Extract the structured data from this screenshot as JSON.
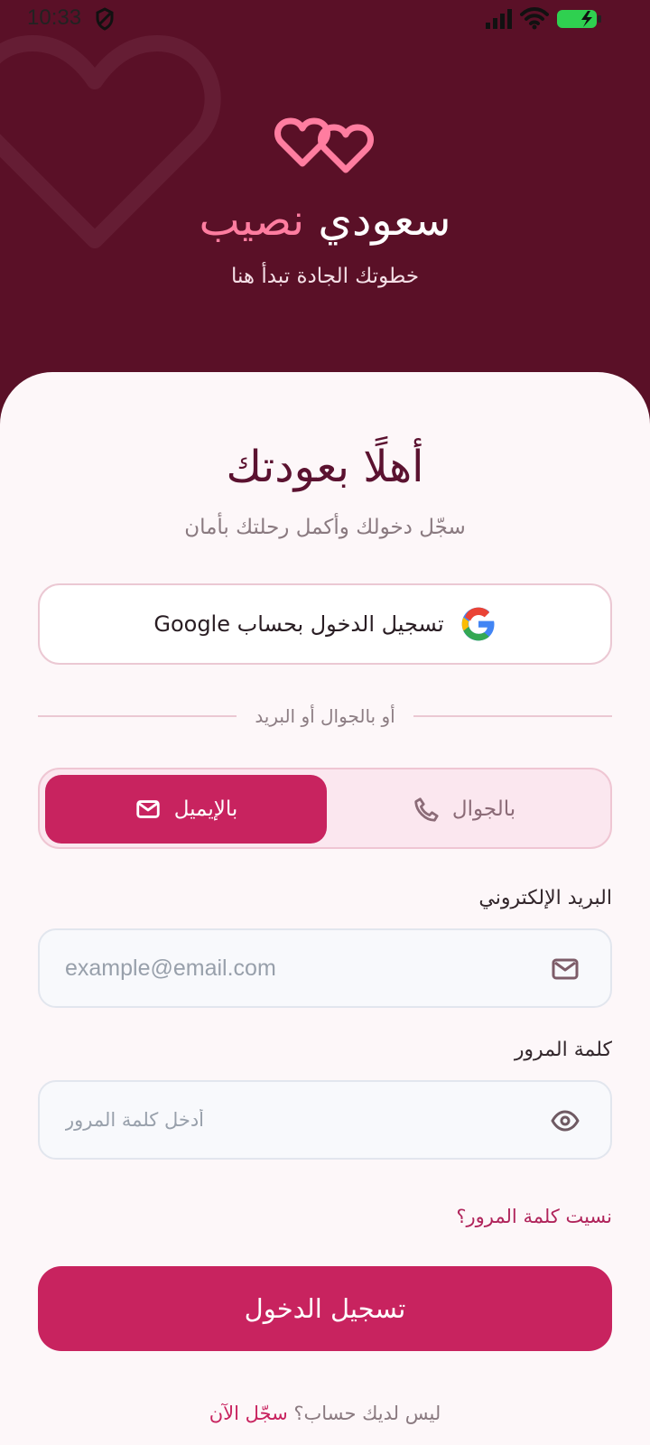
{
  "status_bar": {
    "time": "10:33"
  },
  "header": {
    "brand_main": "سعودي",
    "brand_accent": "نصيب",
    "tagline": "خطوتك الجادة تبدأ هنا"
  },
  "welcome": {
    "title": "أهلًا بعودتك",
    "subtitle": "سجّل دخولك وأكمل رحلتك بأمان"
  },
  "google": {
    "label": "تسجيل الدخول بحساب Google"
  },
  "divider": {
    "label": "أو بالجوال أو البريد"
  },
  "method_toggle": {
    "phone_label": "بالجوال",
    "email_label": "بالإيميل",
    "selected": "بالإيميل"
  },
  "email": {
    "label": "البريد الإلكتروني",
    "placeholder": "example@email.com",
    "value": ""
  },
  "password": {
    "label": "كلمة المرور",
    "placeholder": "أدخل كلمة المرور",
    "value": ""
  },
  "links": {
    "forgot_password": "نسيت كلمة المرور؟"
  },
  "actions": {
    "login": "تسجيل الدخول"
  },
  "signup": {
    "prompt": "ليس لديك حساب؟",
    "link": "سجّل الآن"
  },
  "icons": {
    "status": [
      "shield-icon",
      "signal-icon",
      "wifi-icon",
      "battery-icon"
    ],
    "logo": "hearts-icon",
    "google": "google-icon",
    "phone": "phone-icon",
    "mail": "mail-icon",
    "eye": "eye-icon"
  },
  "colors": {
    "header_background": "#5a1027",
    "accent": "#c8235f",
    "brand_accent": "#ff7da0",
    "card_background": "#fdf7f9"
  }
}
